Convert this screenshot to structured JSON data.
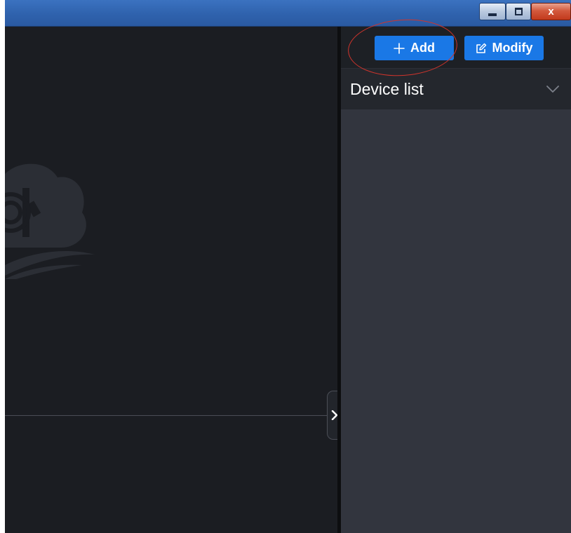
{
  "window": {
    "minimize_icon": "minimize-icon",
    "maximize_icon": "restore-icon",
    "close_label": "x"
  },
  "toolbar": {
    "add_label": "Add",
    "add_icon": "plus-icon",
    "modify_label": "Modify",
    "modify_icon": "edit-icon"
  },
  "device_list": {
    "title": "Device list",
    "expand_icon": "chevron-down-icon",
    "items": []
  },
  "viewport": {
    "watermark_icon": "cloud-camera-icon",
    "toggle_icon": "chevron-right-icon"
  },
  "colors": {
    "accent": "#1a78e6",
    "panel_bg": "#32353e",
    "viewport_bg": "#1b1d22",
    "titlebar": "#2f62ad",
    "highlight": "#d0342c"
  }
}
